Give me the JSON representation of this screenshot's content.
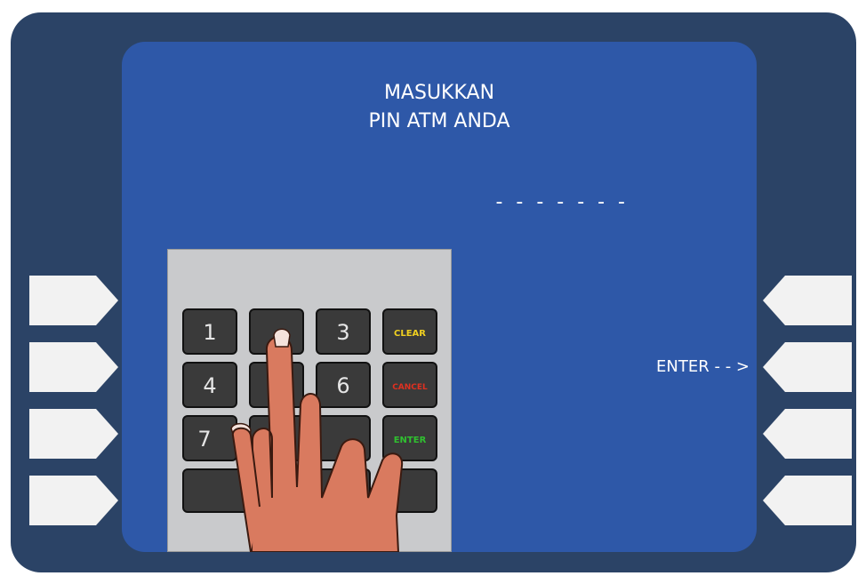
{
  "screen": {
    "title_line1": "MASUKKAN",
    "title_line2": "PIN ATM ANDA",
    "pin_mask": "- - - - - - -"
  },
  "side_labels": {
    "right_2": "ENTER - - >"
  },
  "keypad": {
    "keys": [
      "1",
      "",
      "3",
      "CLEAR",
      "4",
      "",
      "6",
      "CANCEL",
      "7",
      "",
      "9",
      "ENTER"
    ],
    "clear_color": "#f0d020",
    "cancel_color": "#e03020",
    "enter_color": "#30c030"
  },
  "colors": {
    "bezel": "#2b4366",
    "screen": "#2e58a8",
    "side_key": "#f2f2f2"
  }
}
